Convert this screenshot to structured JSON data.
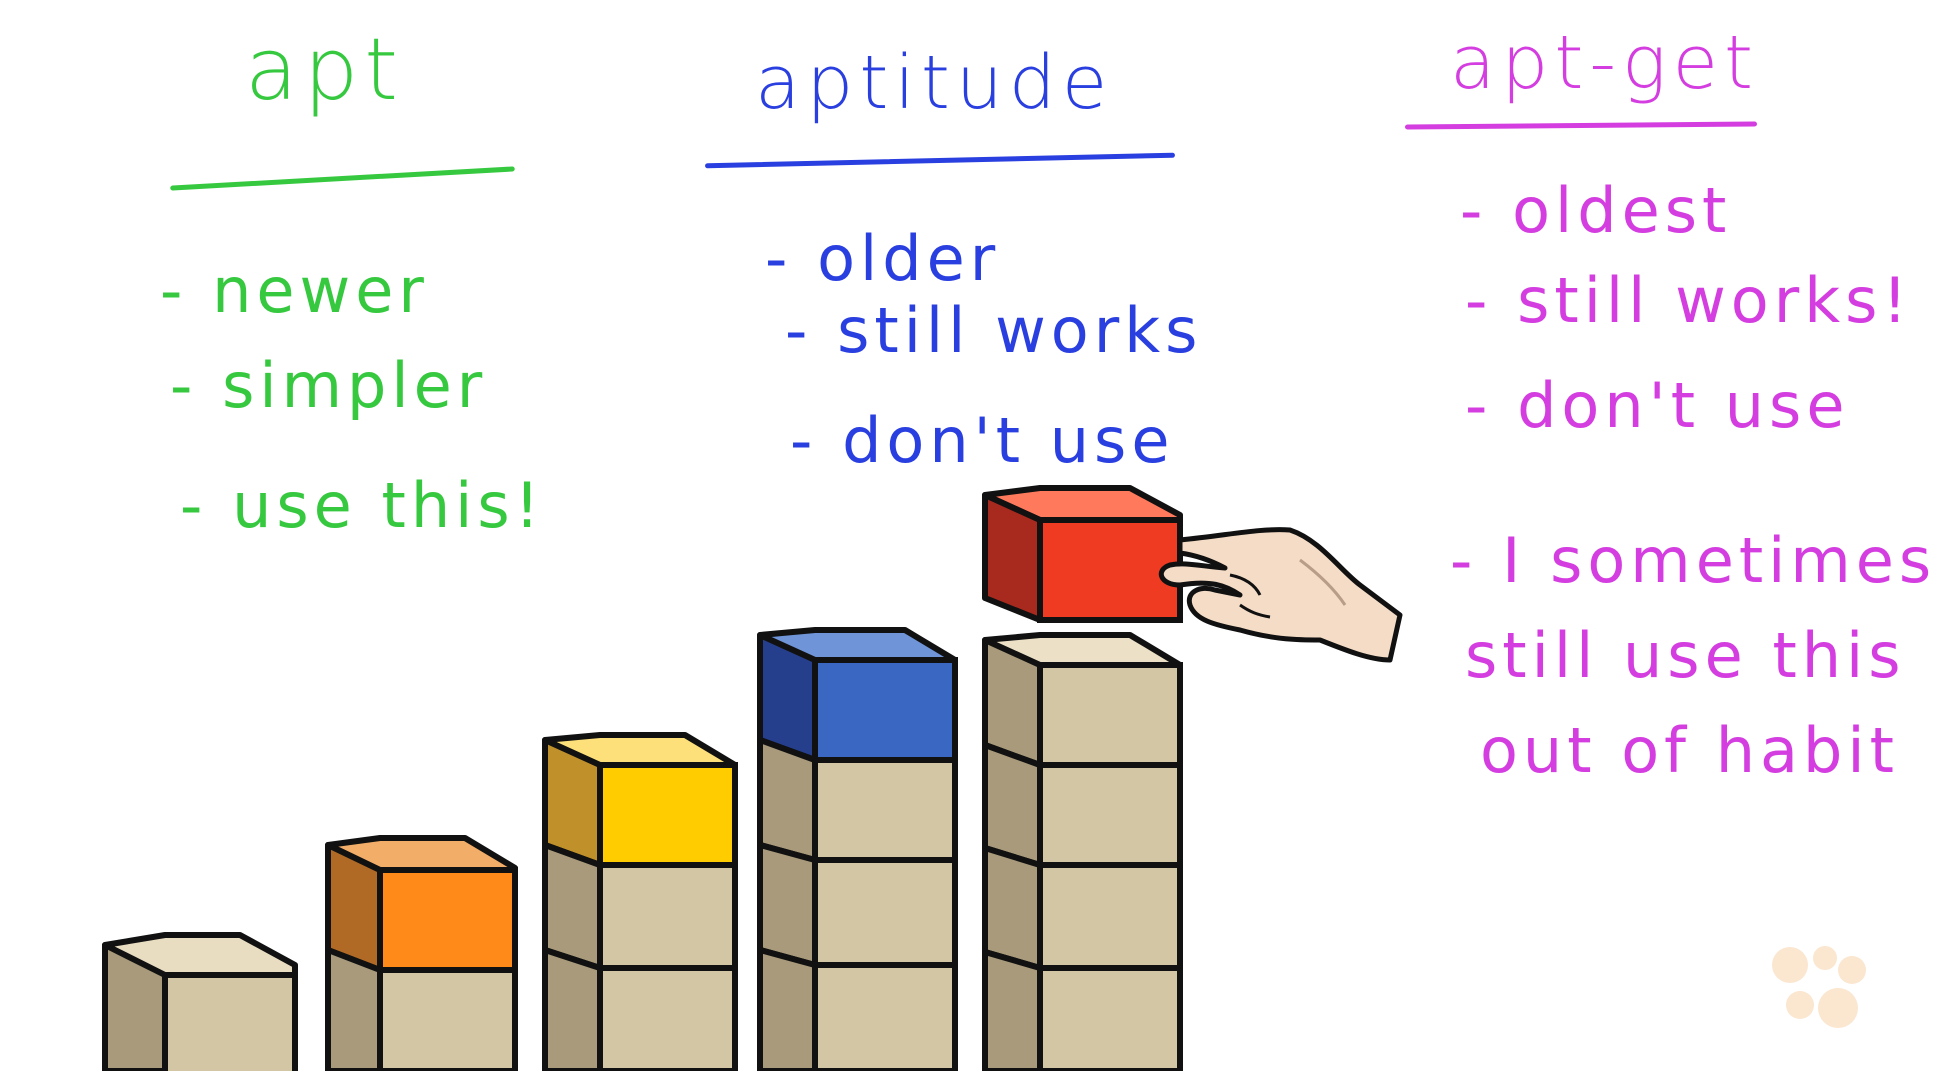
{
  "columns": [
    {
      "title": "apt",
      "color": "#36c93f",
      "items": [
        "- newer",
        "- simpler",
        "- use this!"
      ]
    },
    {
      "title": "aptitude",
      "color": "#2a3fe0",
      "items": [
        "- older",
        "- still works",
        "- don't use"
      ]
    },
    {
      "title": "apt-get",
      "color": "#d43ee0",
      "items": [
        "- oldest",
        "- still works!",
        "- don't use",
        "- I sometimes",
        "still use this",
        "out of habit"
      ]
    }
  ],
  "blocks": {
    "base_color": "#d9c9a6",
    "accent_colors": [
      "#ff8a1a",
      "#ffcc00",
      "#3a67c2",
      "#ee3b22"
    ],
    "hand_icon": "hand-icon"
  }
}
